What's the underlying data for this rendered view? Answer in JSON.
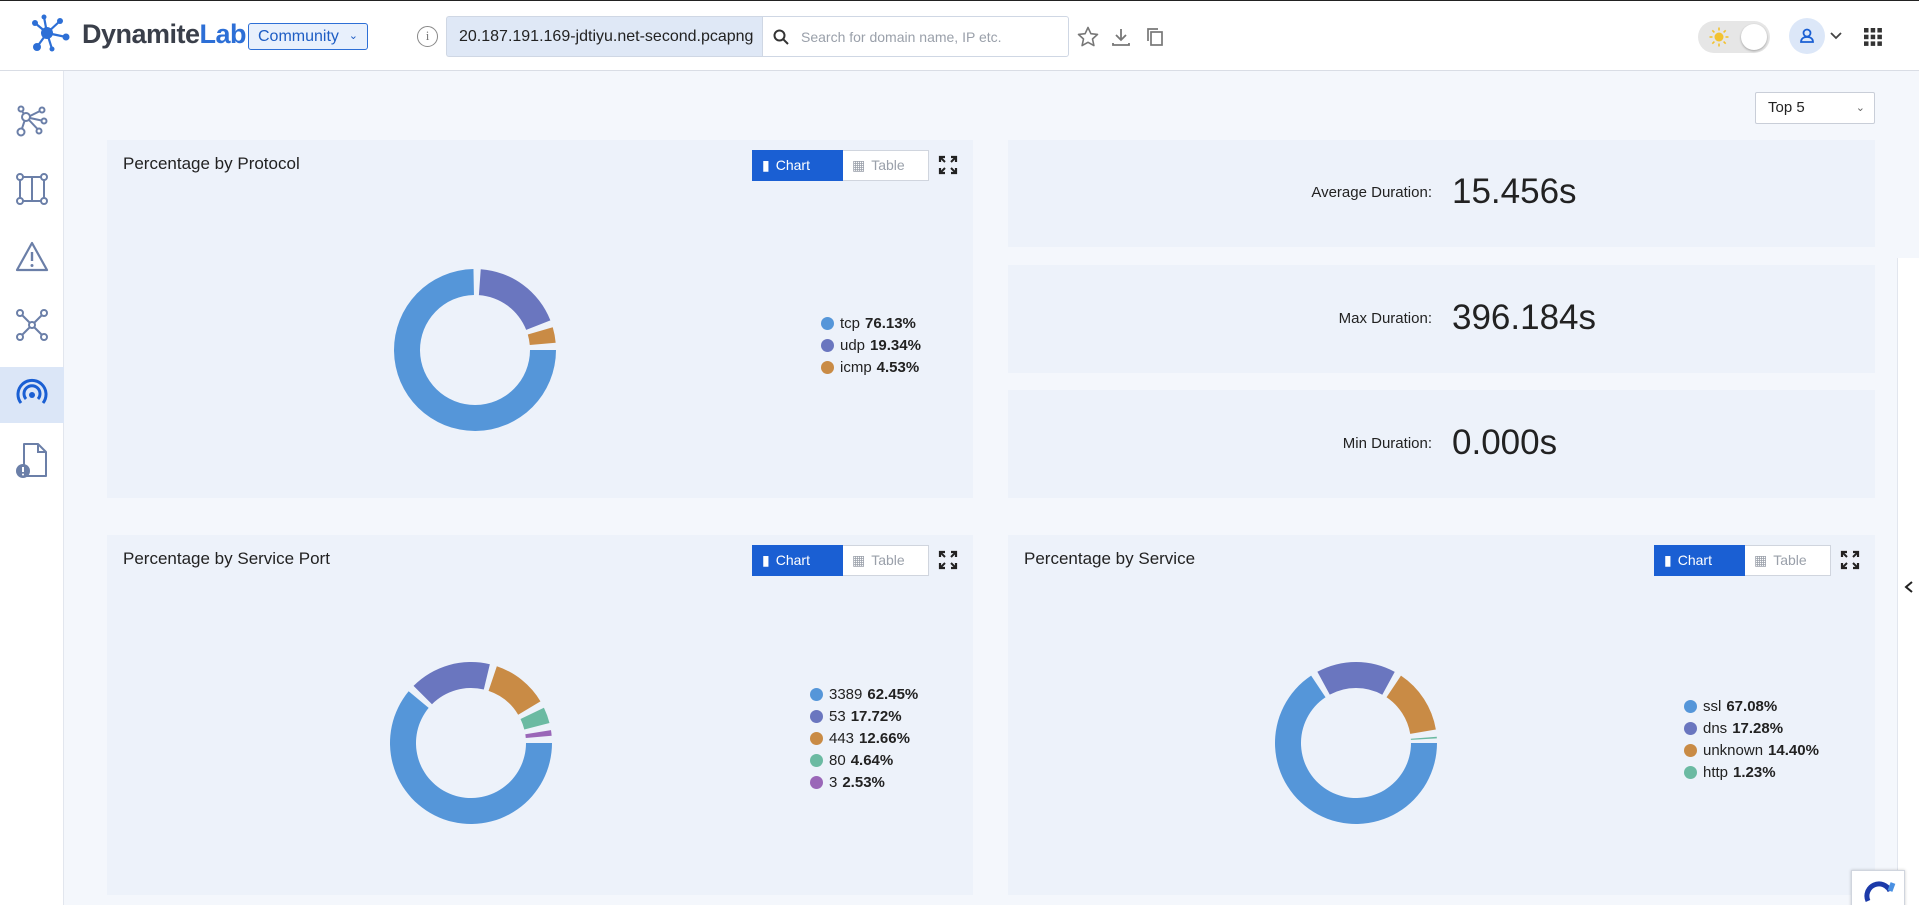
{
  "app": {
    "logo_main": "Dynamite",
    "logo_accent": "Lab",
    "edition": "Community"
  },
  "header": {
    "file_name": "20.187.191.169-jdtiyu.net-second.pcapng",
    "search": {
      "placeholder": "Search for domain name, IP etc.",
      "value": ""
    },
    "icons": [
      "info-icon",
      "search-icon",
      "star-icon",
      "download-icon",
      "copy-icon",
      "sun-icon",
      "user-icon",
      "chevron-down-icon",
      "apps-grid-icon"
    ]
  },
  "sidebar": {
    "items": [
      {
        "name": "network-graph-icon"
      },
      {
        "name": "flows-icon"
      },
      {
        "name": "alerts-icon"
      },
      {
        "name": "hosts-icon"
      },
      {
        "name": "connections-icon",
        "active": true
      },
      {
        "name": "file-alert-icon"
      }
    ]
  },
  "top_n": {
    "value": "Top 5"
  },
  "toggle_labels": {
    "chart": "Chart",
    "table": "Table"
  },
  "stats": {
    "avg": {
      "label": "Average Duration:",
      "value": "15.456s"
    },
    "max": {
      "label": "Max Duration:",
      "value": "396.184s"
    },
    "min": {
      "label": "Min Duration:",
      "value": "0.000s"
    }
  },
  "colors": {
    "blue": "#5596d9",
    "indigo": "#6a76bf",
    "orange": "#c98b45",
    "teal": "#6bbaa2",
    "purple": "#9a67b8",
    "accent": "#1a5fd3"
  },
  "chart_data": [
    {
      "type": "pie",
      "title": "Percentage by Protocol",
      "series": [
        {
          "name": "tcp",
          "label": "76.13%",
          "value": 76.13,
          "color": "#5596d9"
        },
        {
          "name": "udp",
          "label": "19.34%",
          "value": 19.34,
          "color": "#6a76bf"
        },
        {
          "name": "icmp",
          "label": "4.53%",
          "value": 4.53,
          "color": "#c98b45"
        }
      ]
    },
    {
      "type": "pie",
      "title": "Percentage by Service Port",
      "series": [
        {
          "name": "3389",
          "label": "62.45%",
          "value": 62.45,
          "color": "#5596d9"
        },
        {
          "name": "53",
          "label": "17.72%",
          "value": 17.72,
          "color": "#6a76bf"
        },
        {
          "name": "443",
          "label": "12.66%",
          "value": 12.66,
          "color": "#c98b45"
        },
        {
          "name": "80",
          "label": "4.64%",
          "value": 4.64,
          "color": "#6bbaa2"
        },
        {
          "name": "3",
          "label": "2.53%",
          "value": 2.53,
          "color": "#9a67b8"
        }
      ]
    },
    {
      "type": "pie",
      "title": "Percentage by Service",
      "series": [
        {
          "name": "ssl",
          "label": "67.08%",
          "value": 67.08,
          "color": "#5596d9"
        },
        {
          "name": "dns",
          "label": "17.28%",
          "value": 17.28,
          "color": "#6a76bf"
        },
        {
          "name": "unknown",
          "label": "14.40%",
          "value": 14.4,
          "color": "#c98b45"
        },
        {
          "name": "http",
          "label": "1.23%",
          "value": 1.23,
          "color": "#6bbaa2"
        }
      ]
    }
  ]
}
